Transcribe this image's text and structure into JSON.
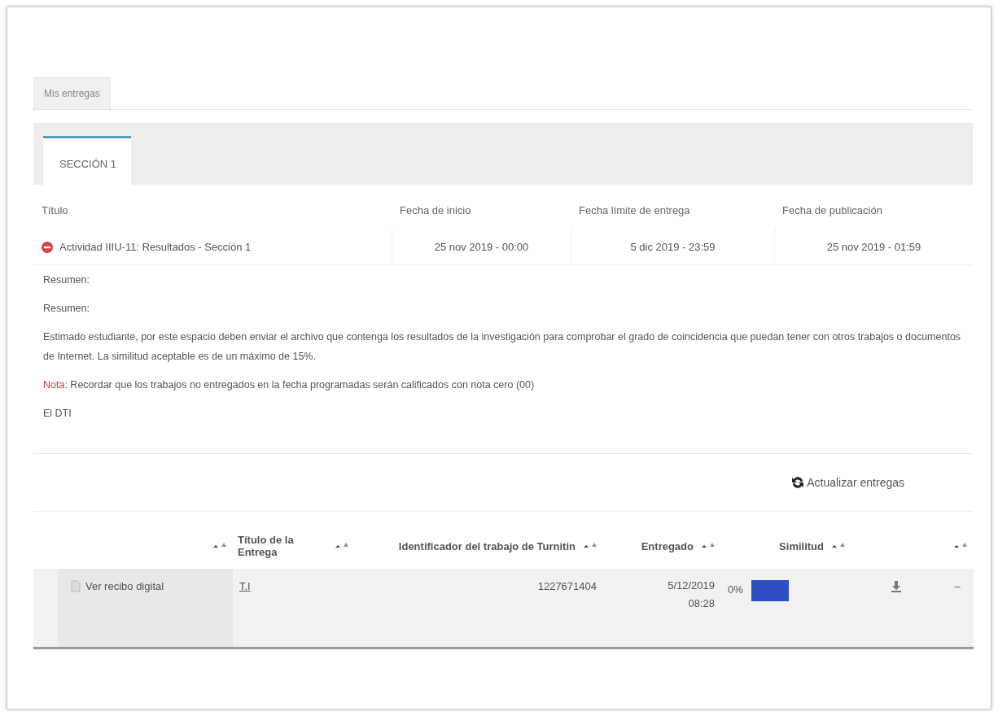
{
  "top_tabs": [
    {
      "label": "Mis entregas",
      "selected": true
    }
  ],
  "section_tabs": [
    {
      "label": "SECCIÓN 1",
      "selected": true
    }
  ],
  "activity_table": {
    "columns": [
      "Título",
      "Fecha de inicio",
      "Fecha límite de entrega",
      "Fecha de publicación"
    ],
    "rows": [
      {
        "kind": "blocked",
        "title": "Actividad IIIU-11: Resultados - Sección 1",
        "start": "25 nov 2019 - 00:00",
        "due": "5 dic 2019 - 23:59",
        "published": "25 nov 2019 - 01:59"
      }
    ]
  },
  "summary": {
    "lines": [
      {
        "kind": "plain",
        "text": "Resumen:"
      },
      {
        "kind": "plain",
        "text": "Resumen:"
      },
      {
        "kind": "plain",
        "text": "Estimado estudiante, por este espacio deben enviar el archivo que contenga los resultados de la investigación para comprobar el grado de coincidencia que puedan tener con otros trabajos o documentos de Internet. La similitud aceptable es de un máximo de 15%."
      },
      {
        "kind": "note",
        "label": "Nota",
        "text": ": Recordar que los trabajos no entregados en la fecha programadas serán calificados con nota cero (00)"
      },
      {
        "kind": "plain",
        "text": "El DTI"
      }
    ]
  },
  "refresh_button": {
    "label": "Actualizar entregas"
  },
  "submissions": {
    "columns": [
      {
        "sortable": true
      },
      {
        "label": "Título de la Entrega",
        "sortable": true
      },
      {
        "label": "Identificador del trabajo de Turnitin",
        "sortable": true
      },
      {
        "label": "Entregado",
        "sortable": true
      },
      {
        "label": "Similitud",
        "sortable": true
      },
      {
        "sortable": false
      },
      {
        "sortable": true
      }
    ],
    "rows": [
      {
        "receipt": "Ver recibo digital",
        "title": "T.I",
        "id": "1227671404",
        "submitted": "5/12/2019 08:28",
        "similarity": "0%",
        "color": "#2f4fc4",
        "more": "–"
      }
    ]
  }
}
